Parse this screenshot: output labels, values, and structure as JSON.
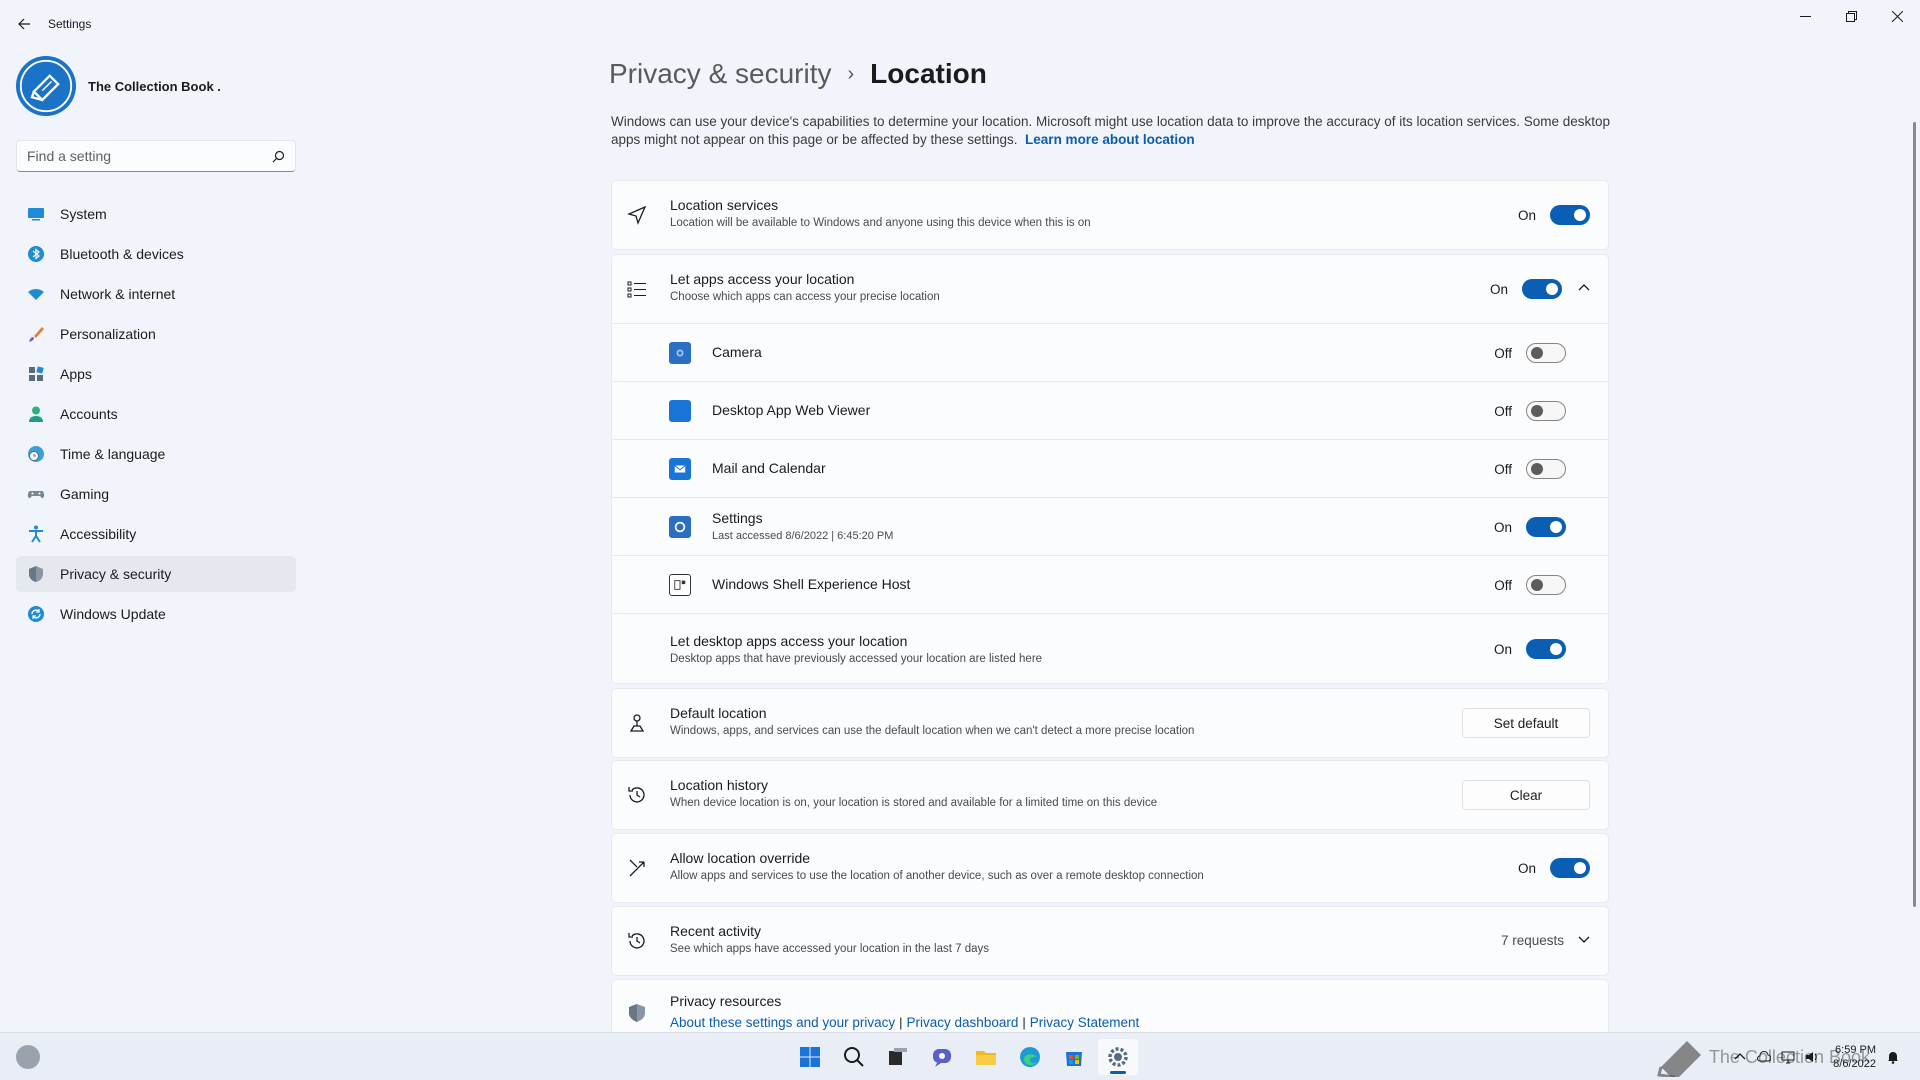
{
  "window": {
    "title": "Settings"
  },
  "profile": {
    "name": "The Collection Book ."
  },
  "search": {
    "placeholder": "Find a setting"
  },
  "nav": [
    {
      "label": "System",
      "icon": "monitor-icon"
    },
    {
      "label": "Bluetooth & devices",
      "icon": "bluetooth-icon"
    },
    {
      "label": "Network & internet",
      "icon": "wifi-icon"
    },
    {
      "label": "Personalization",
      "icon": "brush-icon"
    },
    {
      "label": "Apps",
      "icon": "apps-icon"
    },
    {
      "label": "Accounts",
      "icon": "person-icon"
    },
    {
      "label": "Time & language",
      "icon": "globe-clock-icon"
    },
    {
      "label": "Gaming",
      "icon": "gamepad-icon"
    },
    {
      "label": "Accessibility",
      "icon": "accessibility-icon"
    },
    {
      "label": "Privacy & security",
      "icon": "shield-icon",
      "active": true
    },
    {
      "label": "Windows Update",
      "icon": "update-icon"
    }
  ],
  "breadcrumb": {
    "parent": "Privacy & security",
    "separator": "›",
    "current": "Location"
  },
  "description": {
    "text": "Windows can use your device's capabilities to determine your location. Microsoft might use location data to improve the accuracy of its location services. Some desktop apps might not appear on this page or be affected by these settings.",
    "link": "Learn more about location"
  },
  "location_services": {
    "title": "Location services",
    "subtitle": "Location will be available to Windows and anyone using this device when this is on",
    "state": "On"
  },
  "let_apps": {
    "title": "Let apps access your location",
    "subtitle": "Choose which apps can access your precise location",
    "state": "On",
    "apps": [
      {
        "name": "Camera",
        "state": "Off",
        "detail": ""
      },
      {
        "name": "Desktop App Web Viewer",
        "state": "Off",
        "detail": ""
      },
      {
        "name": "Mail and Calendar",
        "state": "Off",
        "detail": ""
      },
      {
        "name": "Settings",
        "state": "On",
        "detail": "Last accessed 8/6/2022  |  6:45:20 PM"
      },
      {
        "name": "Windows Shell Experience Host",
        "state": "Off",
        "detail": ""
      }
    ],
    "desktop": {
      "title": "Let desktop apps access your location",
      "subtitle": "Desktop apps that have previously accessed your location are listed here",
      "state": "On"
    }
  },
  "default_location": {
    "title": "Default location",
    "subtitle": "Windows, apps, and services can use the default location when we can't detect a more precise location",
    "button": "Set default"
  },
  "location_history": {
    "title": "Location history",
    "subtitle": "When device location is on, your location is stored and available for a limited time on this device",
    "button": "Clear"
  },
  "override": {
    "title": "Allow location override",
    "subtitle": "Allow apps and services to use the location of another device, such as over a remote desktop connection",
    "state": "On"
  },
  "recent_activity": {
    "title": "Recent activity",
    "subtitle": "See which apps have accessed your location in the last 7 days",
    "count": "7 requests"
  },
  "privacy_resources": {
    "title": "Privacy resources",
    "links": [
      "About these settings and your privacy",
      "Privacy dashboard",
      "Privacy Statement"
    ],
    "separator": "|"
  },
  "taskbar": {
    "apps": [
      "start-icon",
      "search-icon",
      "task-view-icon",
      "chat-icon",
      "file-explorer-icon",
      "edge-icon",
      "store-icon",
      "settings-icon"
    ],
    "time": "6:59 PM",
    "date": "8/6/2022",
    "watermark": "The Collection Book"
  },
  "colors": {
    "accent": "#0a5fb4",
    "link": "#0a5cad",
    "background": "#f1f5fb",
    "card": "#fbfcfe"
  }
}
